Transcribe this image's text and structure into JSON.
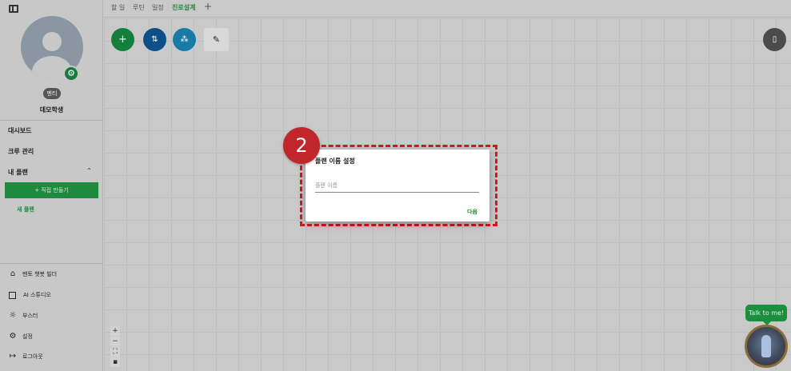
{
  "sidebar": {
    "role_badge": "멘티",
    "user_name": "데모학생",
    "nav": {
      "dashboard": "대시보드",
      "crew": "크루 관리",
      "my_plans": "내 플랜"
    },
    "create_button": "+ 직접 만들기",
    "new_plan": "새 플랜",
    "bottom": [
      {
        "icon": "robot-icon",
        "label": "멘토 챗봇 빌더"
      },
      {
        "icon": "square-icon",
        "label": "AI 스튜디오"
      },
      {
        "icon": "rocket-icon",
        "label": "부스터"
      },
      {
        "icon": "gear-icon",
        "label": "설정"
      },
      {
        "icon": "logout-icon",
        "label": "로그아웃"
      }
    ]
  },
  "tabs": [
    {
      "label": "할 일",
      "active": false
    },
    {
      "label": "루틴",
      "active": false
    },
    {
      "label": "일정",
      "active": false
    },
    {
      "label": "진로설계",
      "active": true
    }
  ],
  "tab_add": "+",
  "step_number": "2",
  "dialog": {
    "title": "플랜 이름 설정",
    "placeholder": "플랜 이름",
    "value": "",
    "next_label": "다음"
  },
  "chat": {
    "bubble": "Talk to me!"
  },
  "colors": {
    "accent_green": "#1e8a3e",
    "highlight_red": "#d9161b",
    "step_badge": "#c0262a"
  }
}
